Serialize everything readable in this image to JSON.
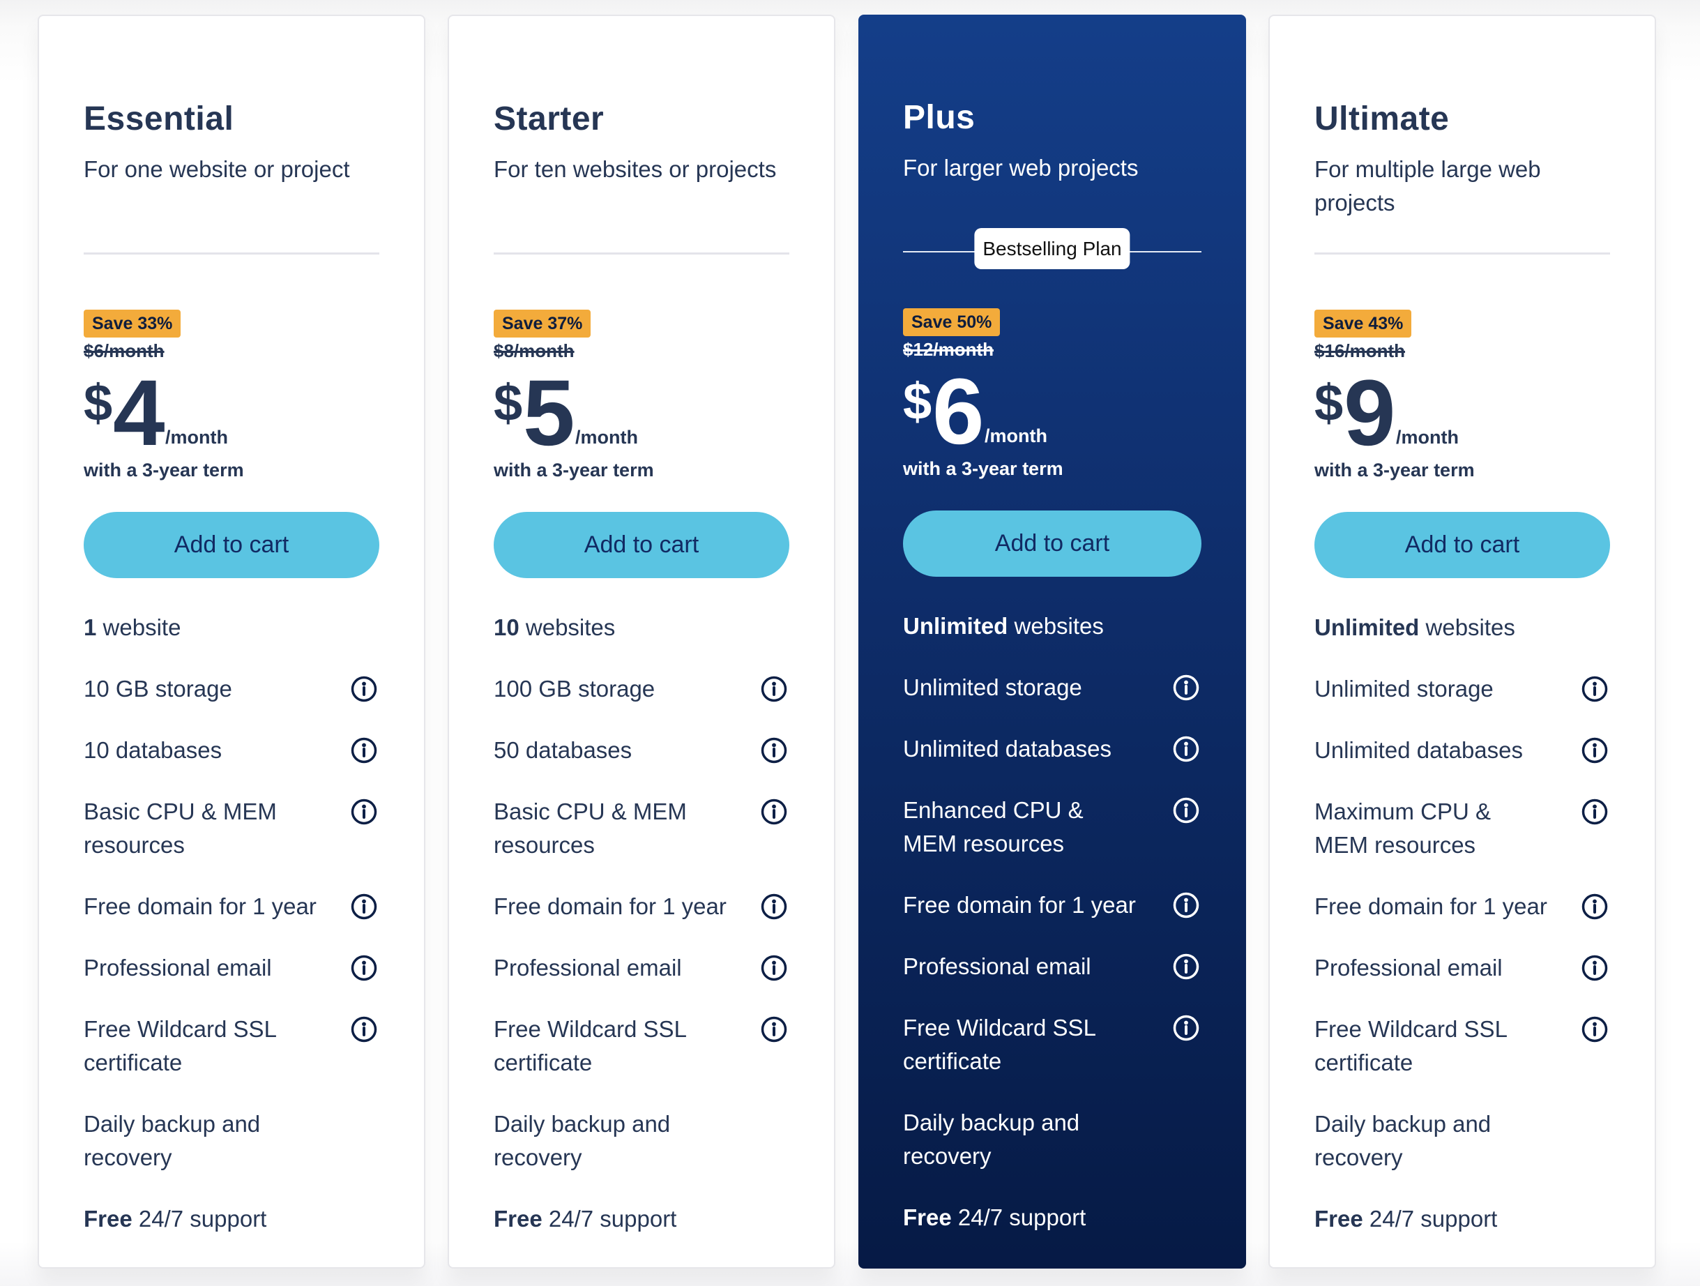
{
  "colors": {
    "text_dark": "#263654",
    "featured_bg_top": "#143e89",
    "featured_bg_bottom": "#061a45",
    "save_badge": "#f3ab3b",
    "cart_button": "#5ac4e2",
    "cart_button_text": "#112a63"
  },
  "plans": [
    {
      "name": "Essential",
      "description": "For one website or project",
      "featured": false,
      "save_label": "Save 33%",
      "old_price": "$6/month",
      "currency": "$",
      "amount": "4",
      "period": "/month",
      "term": "with a 3-year term",
      "cta": "Add to cart",
      "features": [
        {
          "bold": "1",
          "text": " website",
          "info": false
        },
        {
          "bold": "",
          "text": "10 GB storage",
          "info": true
        },
        {
          "bold": "",
          "text": "10 databases",
          "info": true
        },
        {
          "bold": "",
          "text": "Basic CPU & MEM resources",
          "info": true
        },
        {
          "bold": "",
          "text": "Free domain for 1 year",
          "info": true
        },
        {
          "bold": "",
          "text": "Professional email",
          "info": true
        },
        {
          "bold": "",
          "text": "Free Wildcard SSL certificate",
          "info": true
        },
        {
          "bold": "",
          "text": "Daily backup and recovery",
          "info": false
        },
        {
          "bold": "Free",
          "text": " 24/7 support",
          "info": false
        }
      ]
    },
    {
      "name": "Starter",
      "description": "For ten websites or projects",
      "featured": false,
      "save_label": "Save 37%",
      "old_price": "$8/month",
      "currency": "$",
      "amount": "5",
      "period": "/month",
      "term": "with a 3-year term",
      "cta": "Add to cart",
      "features": [
        {
          "bold": "10",
          "text": " websites",
          "info": false
        },
        {
          "bold": "",
          "text": "100 GB storage",
          "info": true
        },
        {
          "bold": "",
          "text": "50 databases",
          "info": true
        },
        {
          "bold": "",
          "text": "Basic CPU & MEM resources",
          "info": true
        },
        {
          "bold": "",
          "text": "Free domain for 1 year",
          "info": true
        },
        {
          "bold": "",
          "text": "Professional email",
          "info": true
        },
        {
          "bold": "",
          "text": "Free Wildcard SSL certificate",
          "info": true
        },
        {
          "bold": "",
          "text": "Daily backup and recovery",
          "info": false
        },
        {
          "bold": "Free",
          "text": " 24/7 support",
          "info": false
        }
      ]
    },
    {
      "name": "Plus",
      "description": "For larger web projects",
      "featured": true,
      "featured_label": "Bestselling Plan",
      "save_label": "Save 50%",
      "old_price": "$12/month",
      "currency": "$",
      "amount": "6",
      "period": "/month",
      "term": "with a 3-year term",
      "cta": "Add to cart",
      "features": [
        {
          "bold": "Unlimited",
          "text": " websites",
          "info": false
        },
        {
          "bold": "",
          "text": "Unlimited storage",
          "info": true
        },
        {
          "bold": "",
          "text": "Unlimited databases",
          "info": true
        },
        {
          "bold": "",
          "text": "Enhanced CPU & MEM resources",
          "info": true
        },
        {
          "bold": "",
          "text": "Free domain for 1 year",
          "info": true
        },
        {
          "bold": "",
          "text": "Professional email",
          "info": true
        },
        {
          "bold": "",
          "text": "Free Wildcard SSL certificate",
          "info": true
        },
        {
          "bold": "",
          "text": "Daily backup and recovery",
          "info": false
        },
        {
          "bold": "Free",
          "text": " 24/7 support",
          "info": false
        }
      ]
    },
    {
      "name": "Ultimate",
      "description": "For multiple large web projects",
      "featured": false,
      "save_label": "Save 43%",
      "old_price": "$16/month",
      "currency": "$",
      "amount": "9",
      "period": "/month",
      "term": "with a 3-year term",
      "cta": "Add to cart",
      "features": [
        {
          "bold": "Unlimited",
          "text": " websites",
          "info": false
        },
        {
          "bold": "",
          "text": "Unlimited storage",
          "info": true
        },
        {
          "bold": "",
          "text": "Unlimited databases",
          "info": true
        },
        {
          "bold": "",
          "text": "Maximum CPU & MEM resources",
          "info": true
        },
        {
          "bold": "",
          "text": "Free domain for 1 year",
          "info": true
        },
        {
          "bold": "",
          "text": "Professional email",
          "info": true
        },
        {
          "bold": "",
          "text": "Free Wildcard SSL certificate",
          "info": true
        },
        {
          "bold": "",
          "text": "Daily backup and recovery",
          "info": false
        },
        {
          "bold": "Free",
          "text": " 24/7 support",
          "info": false
        }
      ]
    }
  ]
}
